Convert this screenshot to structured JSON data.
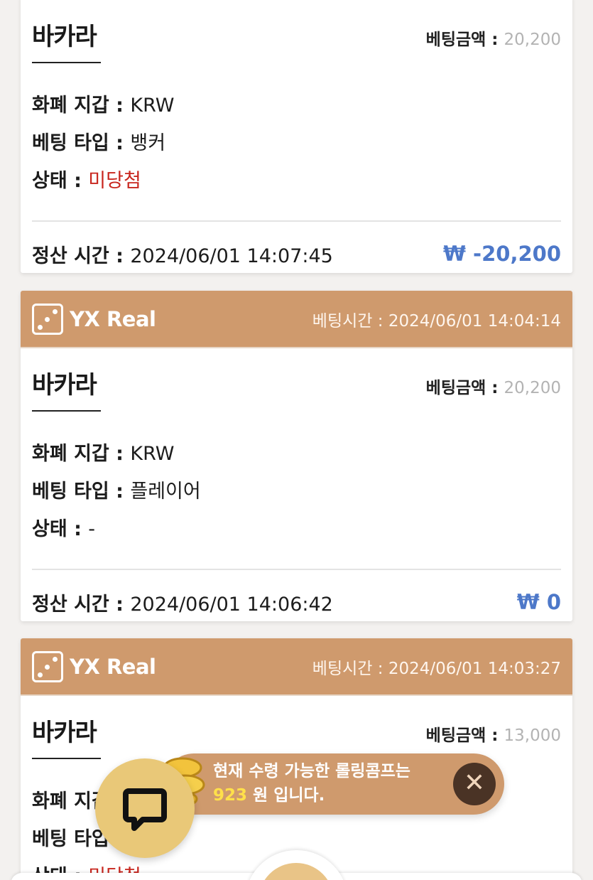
{
  "labels": {
    "bet_amount": "베팅금액 : ",
    "wallet": "화폐 지갑 : ",
    "bet_type": "베팅 타입 : ",
    "status": "상태 : ",
    "settle_time": "정산 시간 : ",
    "bet_time": "베팅시간 : "
  },
  "cards": [
    {
      "provider": "",
      "bet_time": "",
      "game": "바카라",
      "bet_amount": "20,200",
      "wallet": "KRW",
      "bet_type": "뱅커",
      "status": "미당첨",
      "settle_time": "2024/06/01 14:07:45",
      "result_amount": "₩ -20,200"
    },
    {
      "provider": "YX Real",
      "bet_time": "2024/06/01 14:04:14",
      "game": "바카라",
      "bet_amount": "20,200",
      "wallet": "KRW",
      "bet_type": "플레이어",
      "status": "-",
      "settle_time": "2024/06/01 14:06:42",
      "result_amount": "₩ 0"
    },
    {
      "provider": "YX Real",
      "bet_time": "2024/06/01 14:03:27",
      "game": "바카라",
      "bet_amount": "13,000",
      "wallet": "화폐 지갑",
      "bet_type": "베팅 타입",
      "status": "미당첨"
    }
  ],
  "popup": {
    "line1": "현재 수령 가능한 롤링콤프는",
    "amount": "923",
    "line2_suffix": " 원 입니다.",
    "close_icon": "close-icon"
  },
  "colors": {
    "header_bg": "#cf9a6d",
    "status_red": "#c8261e",
    "amount_blue": "#4d78c9",
    "chat_button": "#e9c878",
    "popup_highlight": "#ffe04a"
  }
}
